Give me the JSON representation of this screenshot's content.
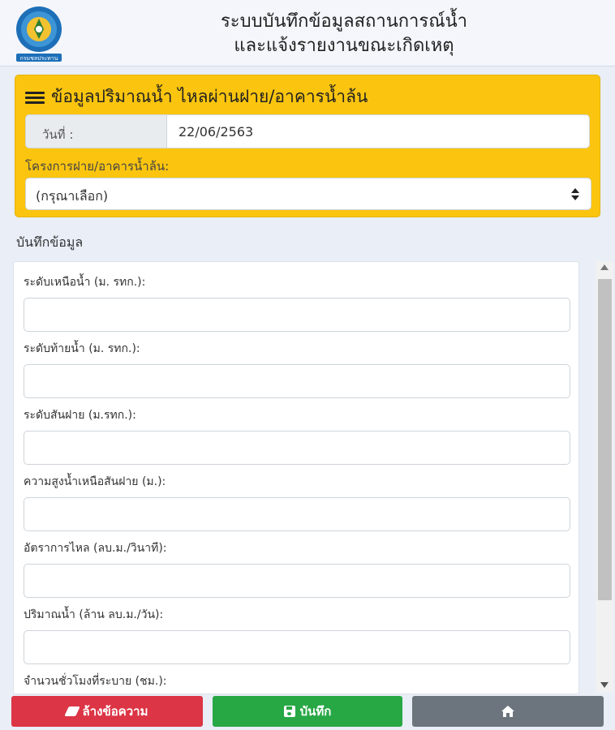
{
  "header": {
    "logo_text": "กรมชลประทาน",
    "title_line1": "ระบบบันทึกข้อมูลสถานการณ์น้ำ",
    "title_line2": "และแจ้งรายงานขณะเกิดเหตุ"
  },
  "panel": {
    "title": "ข้อมูลปริมาณน้ำ ไหลผ่านฝาย/อาคารน้ำล้น",
    "date_label": "วันที่ :",
    "date_value": "22/06/2563",
    "project_label": "โครงการฝาย/อาคารน้ำล้น:",
    "project_selected": "(กรุณาเลือก)"
  },
  "form": {
    "section_label": "บันทึกข้อมูล",
    "fields": [
      {
        "label": "ระดับเหนือน้ำ (ม. รทก.):",
        "value": ""
      },
      {
        "label": "ระดับท้ายน้ำ (ม. รทก.):",
        "value": ""
      },
      {
        "label": "ระดับสันฝาย (ม.รทก.):",
        "value": ""
      },
      {
        "label": "ความสูงน้ำเหนือสันฝาย (ม.):",
        "value": ""
      },
      {
        "label": "อัตราการไหล (ลบ.ม./วินาที):",
        "value": ""
      },
      {
        "label": "ปริมาณน้ำ (ล้าน ลบ.ม./วัน):",
        "value": ""
      },
      {
        "label": "จำนวนชั่วโมงที่ระบาย (ชม.):",
        "value": ""
      }
    ]
  },
  "buttons": {
    "clear_label": "ล้างข้อความ",
    "save_label": "บันทึก",
    "home_icon": "home-icon"
  },
  "colors": {
    "panel_bg": "#fbc50f",
    "clear_btn": "#dc3545",
    "save_btn": "#28a745",
    "home_btn": "#6c757d"
  }
}
